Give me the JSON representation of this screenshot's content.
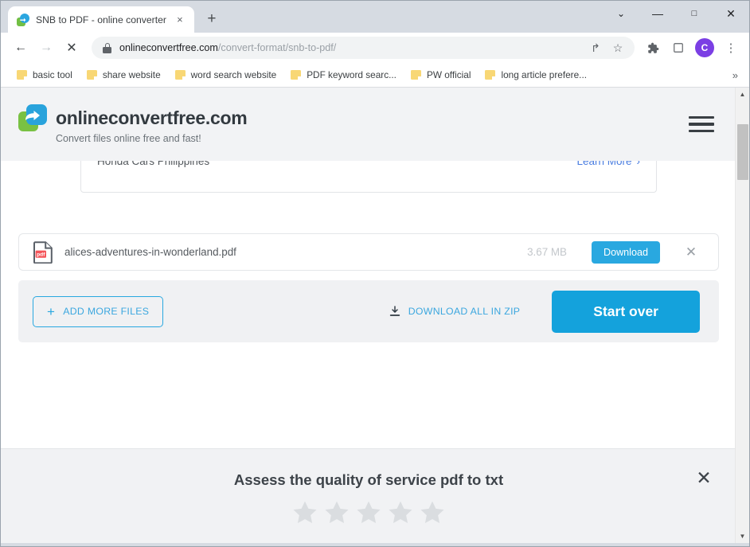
{
  "browser": {
    "tab": {
      "title": "SNB to PDF - online converter",
      "favicon": "converter-logo-icon",
      "close_label": "×"
    },
    "new_tab_label": "+",
    "window_controls": {
      "tab_search": "⌄",
      "minimize": "—",
      "maximize": "□",
      "close": "✕"
    },
    "nav": {
      "back": "←",
      "forward": "→",
      "stop": "✕"
    },
    "omnibox": {
      "domain": "onlineconvertfree.com",
      "path": "/convert-format/snb-to-pdf/",
      "lock": "lock-icon",
      "share": "↱",
      "bookmark": "☆"
    },
    "toolbar_icons": {
      "extensions": "puzzle-icon",
      "side_panel": "□",
      "profile_initial": "C",
      "menu": "⋮"
    },
    "bookmarks": [
      {
        "label": "basic tool"
      },
      {
        "label": "share website"
      },
      {
        "label": "word search website"
      },
      {
        "label": "PDF keyword searc..."
      },
      {
        "label": "PW official"
      },
      {
        "label": "long article prefere..."
      }
    ],
    "bookmarks_overflow": "»"
  },
  "site": {
    "brand_name": "onlineconvertfree.com",
    "tagline": "Convert files online free and fast!",
    "menu_label": "menu"
  },
  "ad": {
    "title": "Honda Cars Philippines",
    "link_label": "Learn More",
    "link_chevron": "›"
  },
  "file": {
    "icon_badge": "pdf",
    "name": "alices-adventures-in-wonderland.pdf",
    "size": "3.67 MB",
    "download_label": "Download",
    "remove_label": "✕"
  },
  "actions": {
    "add_more_label": "ADD MORE FILES",
    "add_more_plus": "+",
    "download_zip_label": "DOWNLOAD ALL IN ZIP",
    "start_over_label": "Start over"
  },
  "rating": {
    "title": "Assess the quality of service pdf to txt",
    "stars": 5,
    "filled": 0,
    "close_label": "✕"
  },
  "colors": {
    "accent_blue": "#29a8e0",
    "start_over_blue": "#14a2dc",
    "logo_green": "#79c143",
    "pdf_red": "#f4555a",
    "star_gray": "#dadde0",
    "profile_purple": "#7b3fe4"
  }
}
